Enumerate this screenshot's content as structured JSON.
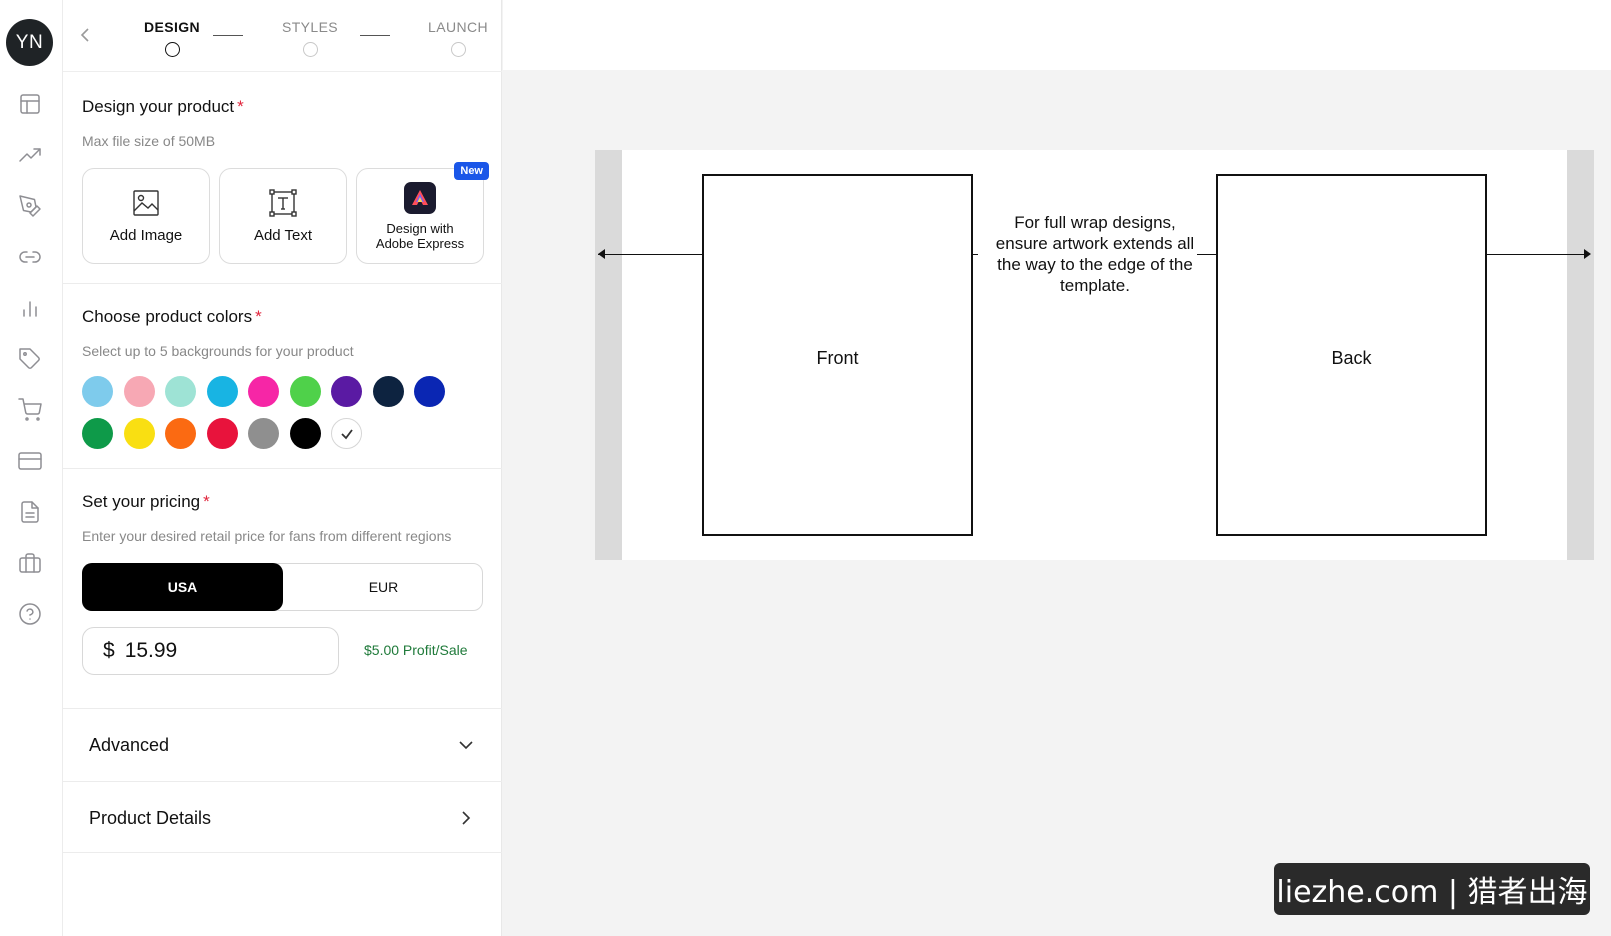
{
  "user": {
    "initials": "YN"
  },
  "rail": {
    "icons": [
      "layout-icon",
      "trend-icon",
      "pen-icon",
      "link-icon",
      "bar-chart-icon",
      "tag-icon",
      "cart-icon",
      "card-icon",
      "document-icon",
      "briefcase-icon",
      "help-icon"
    ]
  },
  "steps": [
    {
      "label": "DESIGN",
      "active": true
    },
    {
      "label": "STYLES",
      "active": false
    },
    {
      "label": "LAUNCH",
      "active": false
    }
  ],
  "design": {
    "title": "Design your product",
    "required_mark": "*",
    "hint": "Max file size of 50MB",
    "tools": [
      {
        "label": "Add Image",
        "icon": "image-icon"
      },
      {
        "label": "Add Text",
        "icon": "text-box-icon"
      },
      {
        "label": "Design with Adobe Express",
        "line1": "Design with",
        "line2": "Adobe Express",
        "icon": "adobe-express-icon",
        "badge": "New"
      }
    ]
  },
  "colors": {
    "title": "Choose product colors",
    "required_mark": "*",
    "hint": "Select up to 5 backgrounds for your product",
    "swatches": [
      "#7ecbec",
      "#f7a8b4",
      "#9ee3d5",
      "#18b4e3",
      "#f626a6",
      "#4fd14a",
      "#5a1aa3",
      "#0d2340",
      "#0a26b3",
      "#0e9a49",
      "#f9df12",
      "#fb6a12",
      "#e8133c",
      "#8f8f8f",
      "#000000",
      "#ffffff"
    ],
    "selected": "#ffffff"
  },
  "pricing": {
    "title": "Set your pricing",
    "required_mark": "*",
    "hint": "Enter your desired retail price for fans from different regions",
    "regions": [
      "USA",
      "EUR"
    ],
    "active_region": "USA",
    "currency": "$",
    "price": "15.99",
    "profit": "$5.00 Profit/Sale"
  },
  "accordions": [
    {
      "title": "Advanced",
      "icon": "chevron-down-icon"
    },
    {
      "title": "Product Details",
      "icon": "chevron-right-icon"
    }
  ],
  "template": {
    "front_label": "Front",
    "back_label": "Back",
    "note": "For full wrap designs, ensure artwork extends all the way to the edge of the template."
  },
  "watermark": "liezhe.com | 猎者出海"
}
